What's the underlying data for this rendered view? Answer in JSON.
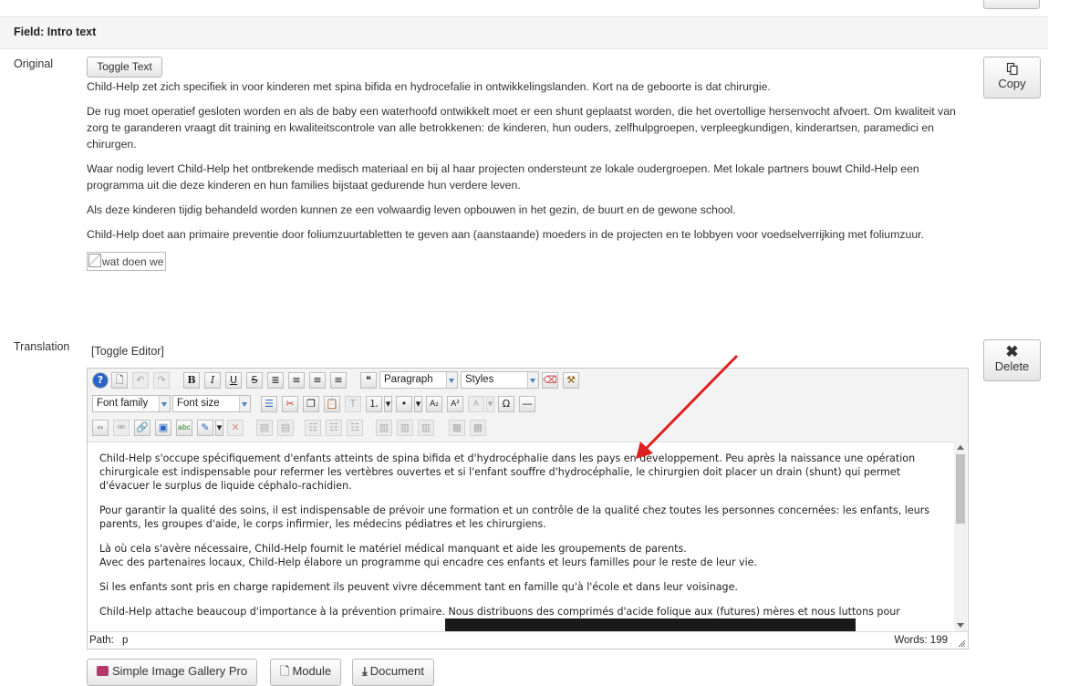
{
  "field": {
    "title": "Field: Intro text"
  },
  "original": {
    "label": "Original",
    "toggle_text": "Toggle Text",
    "paragraphs": [
      "Child-Help zet zich specifiek in voor kinderen met spina bifida en hydrocefalie in ontwikkelingslanden. Kort na de geboorte is dat chirurgie.",
      "De rug moet operatief gesloten worden en als de baby een waterhoofd ontwikkelt moet er een shunt geplaatst worden, die het overtollige hersenvocht afvoert. Om kwaliteit van zorg te garanderen vraagt dit training en kwaliteitscontrole van alle betrokkenen: de kinderen, hun ouders, zelfhulpgroepen, verpleegkundigen, kinderartsen, paramedici en chirurgen.",
      "Waar nodig levert Child-Help het ontbrekende medisch materiaal en bij al haar projecten ondersteunt ze lokale oudergroepen. Met lokale partners bouwt Child-Help een programma uit die deze kinderen en hun families bijstaat gedurende hun verdere leven.",
      "Als deze kinderen tijdig behandeld worden kunnen ze  een volwaardig leven opbouwen in het gezin, de buurt en de gewone school.",
      "Child-Help doet aan primaire preventie door foliumzuurtabletten te geven aan (aanstaande) moeders in de projecten en te lobbyen voor voedselverrijking met foliumzuur."
    ],
    "image_alt": "wat doen we",
    "copy_label": "Copy",
    "copy_icon": "copy-icon"
  },
  "translation": {
    "label": "Translation",
    "toggle_editor": "[Toggle Editor]",
    "delete_label": "Delete",
    "delete_icon": "close-icon",
    "toolbar": {
      "format_select": "Paragraph",
      "styles_select": "Styles",
      "font_family": "Font family",
      "font_size": "Font size"
    },
    "paragraphs": [
      "Child-Help s'occupe spécifiquement d'enfants atteints de spina bifida et d'hydrocéphalie dans les pays en développement. Peu après la naissance une opération chirurgicale est indispensable pour refermer les vertèbres ouvertes  et si l'enfant souffre d'hydrocéphalie, le chirurgien doit placer un drain (shunt) qui permet d'évacuer le surplus de liquide  céphalo-rachidien.",
      "Pour garantir la qualité des soins, il est indispensable de prévoir une  formation  et un contrôle de la qualité  chez toutes les personnes concernées:  les enfants, leurs parents, les groupes d'aide, le corps infirmier, les médecins pédiatres et les chirurgiens.",
      "Là où cela s'avère nécessaire, Child-Help fournit le matériel médical manquant  et aide les groupements de parents.",
      "Avec  des partenaires locaux, Child-Help élabore un programme qui encadre ces enfants et leurs familles pour le reste de leur vie.",
      "Si les enfants sont pris en charge rapidement ils peuvent vivre décemment tant en famille qu'à l'école et dans leur voisinage.",
      "Child-Help attache beaucoup d'importance à la prévention primaire. Nous distribuons des comprimés d'acide folique aux (futures) mères et nous luttons pour"
    ],
    "path_label": "Path:",
    "path_value": "p",
    "words": "Words: 199"
  },
  "bottom_buttons": {
    "gallery": "Simple Image Gallery Pro",
    "module": "Module",
    "document": "Document"
  },
  "annotation": {
    "color": "#e02020"
  }
}
